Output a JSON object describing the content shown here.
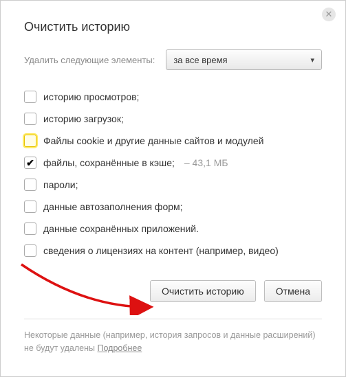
{
  "title": "Очистить историю",
  "period": {
    "label": "Удалить следующие элементы:",
    "selected": "за все время"
  },
  "options": [
    {
      "label": "историю просмотров;",
      "checked": false,
      "highlighted": false
    },
    {
      "label": "историю загрузок;",
      "checked": false,
      "highlighted": false
    },
    {
      "label": "Файлы cookie и другие данные сайтов и модулей",
      "checked": false,
      "highlighted": true
    },
    {
      "label": "файлы, сохранённые в кэше;",
      "extra": "– 43,1 МБ",
      "checked": true,
      "highlighted": false
    },
    {
      "label": "пароли;",
      "checked": false,
      "highlighted": false
    },
    {
      "label": "данные автозаполнения форм;",
      "checked": false,
      "highlighted": false
    },
    {
      "label": "данные сохранённых приложений.",
      "checked": false,
      "highlighted": false
    },
    {
      "label": "сведения о лицензиях на контент (например, видео)",
      "checked": false,
      "highlighted": false
    }
  ],
  "actions": {
    "clear": "Очистить историю",
    "cancel": "Отмена"
  },
  "footer": {
    "text": "Некоторые данные (например, история запросов и данные расширений) не будут удалены ",
    "link": "Подробнее"
  }
}
